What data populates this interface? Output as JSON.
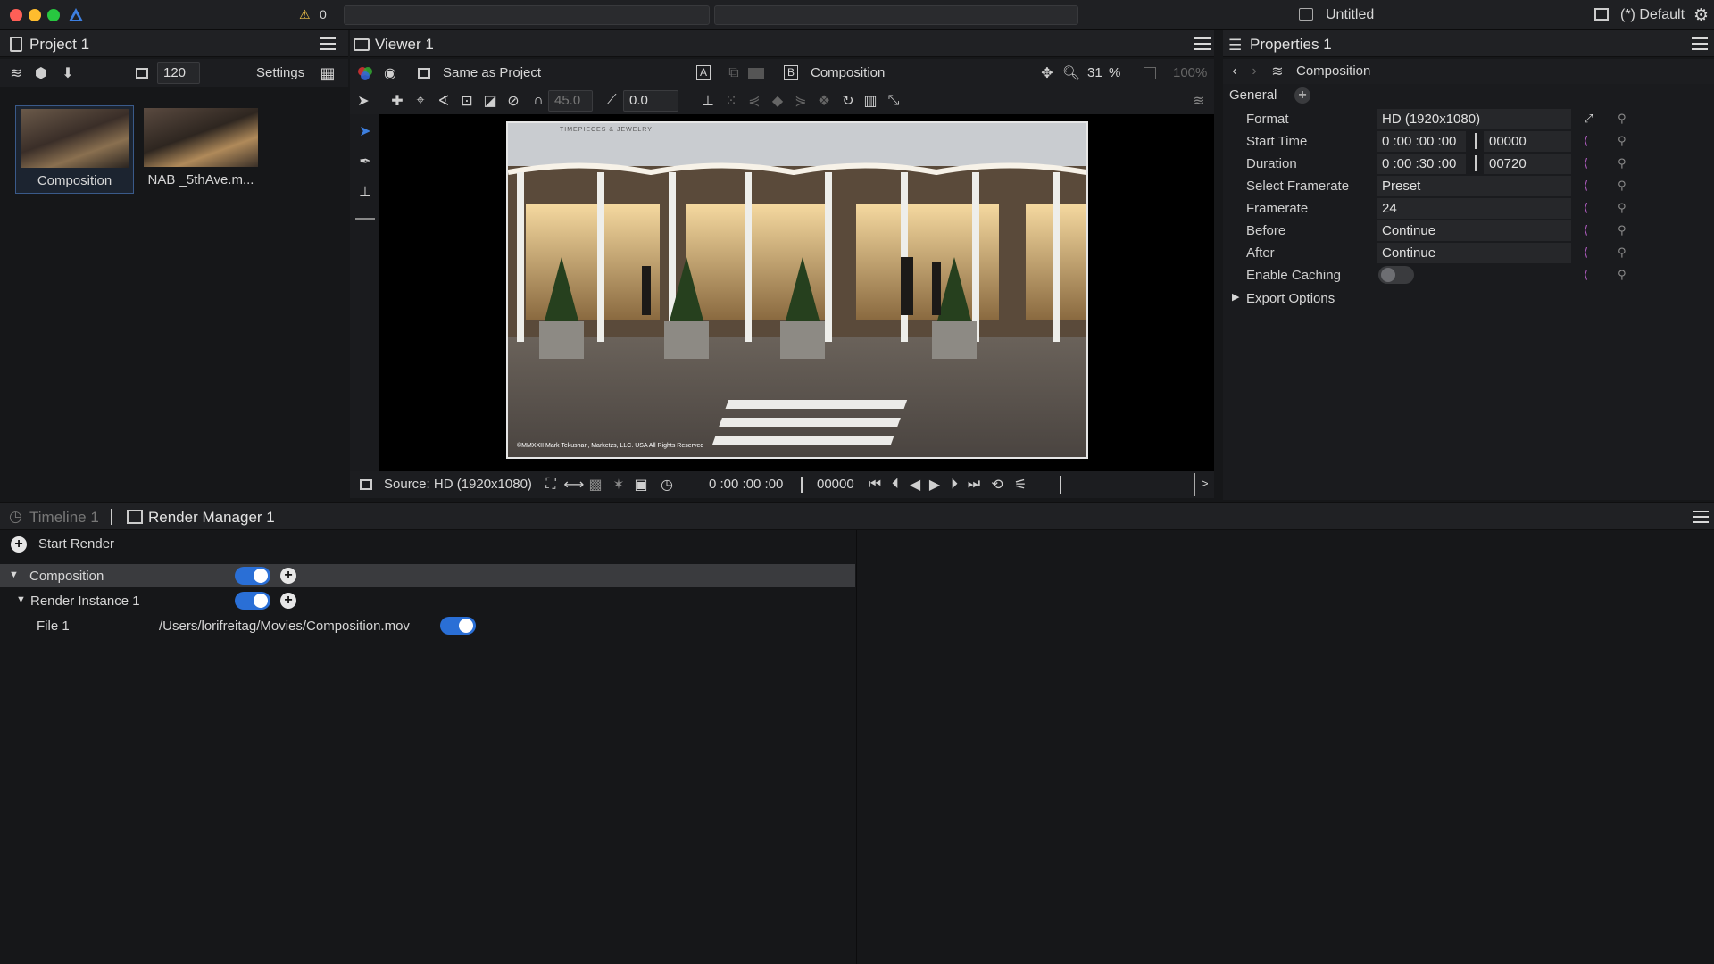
{
  "window": {
    "title": "Untitled",
    "workspace": "(*) Default",
    "warning_count": "0"
  },
  "project": {
    "title": "Project 1",
    "count": "120",
    "settings_label": "Settings",
    "items": [
      {
        "name": "Composition"
      },
      {
        "name": "NAB _5thAve.m..."
      }
    ]
  },
  "viewer": {
    "title": "Viewer 1",
    "same_as_project": "Same as Project",
    "label_a": "A",
    "label_b": "B",
    "composition": "Composition",
    "zoom": "31",
    "zoom_unit": "%",
    "zoom_full": "100%",
    "angle_value": "45.0",
    "value_2": "0.0",
    "source": "Source: HD (1920x1080)",
    "timecode": "0 :00 :00 :00",
    "frame": "00000",
    "more": ">",
    "image": {
      "sign_text": "TIMEPIECES & JEWELRY",
      "copyright": "©MMXXII Mark Tekushan, Marketzs, LLC. USA All Rights Reserved"
    }
  },
  "properties": {
    "title": "Properties 1",
    "breadcrumb": "Composition",
    "section": "General",
    "rows": [
      {
        "key": "Format",
        "value": "HD (1920x1080)"
      },
      {
        "key": "Start Time",
        "value": "0 :00 :00 :00",
        "frames": "00000"
      },
      {
        "key": "Duration",
        "value": "0 :00 :30 :00",
        "frames": "00720"
      },
      {
        "key": "Select Framerate",
        "value": "Preset"
      },
      {
        "key": "Framerate",
        "value": "24"
      },
      {
        "key": "Before",
        "value": "Continue"
      },
      {
        "key": "After",
        "value": "Continue"
      },
      {
        "key": "Enable Caching",
        "value": ""
      }
    ],
    "export_options": "Export Options"
  },
  "bottom_tabs": {
    "timeline": "Timeline 1",
    "render_manager": "Render Manager 1"
  },
  "render": {
    "start_label": "Start Render",
    "composition": "Composition",
    "instance": "Render Instance 1",
    "file_label": "File 1",
    "file_path": "/Users/lorifreitag/Movies/Composition.mov"
  },
  "colors": {
    "accent": "#2a6fd6",
    "panel": "#161719",
    "header": "#202124"
  }
}
